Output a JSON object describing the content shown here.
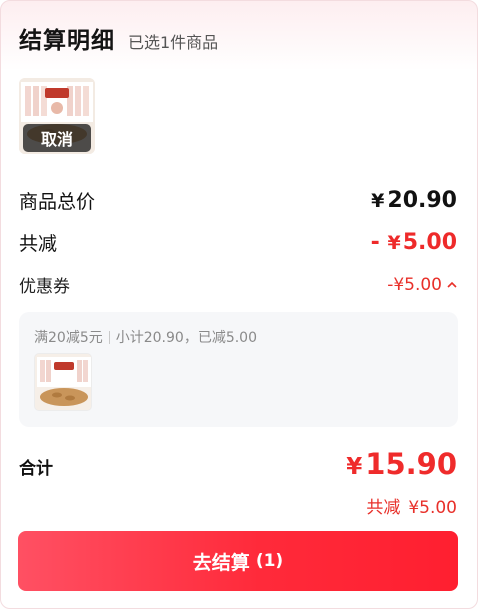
{
  "header": {
    "title": "结算明细",
    "subtitle": "已选1件商品"
  },
  "product": {
    "image_icon": "snack-package-image",
    "cancel_label": "取消"
  },
  "summary": {
    "goods_total_label": "商品总价",
    "goods_total_currency": "¥",
    "goods_total_value": "20.90",
    "discount_label": "共减",
    "discount_prefix": "-",
    "discount_currency": "¥",
    "discount_value": "5.00",
    "coupon_label": "优惠券",
    "coupon_value": "-¥5.00",
    "coupon_chevron_icon": "chevron-up-icon"
  },
  "coupon_card": {
    "rule": "满20减5元",
    "detail": "小计20.90，已减5.00"
  },
  "total": {
    "label": "合计",
    "currency": "¥",
    "value": "15.90",
    "saved_label": "共减",
    "saved_value": "¥5.00"
  },
  "checkout": {
    "label": "去结算",
    "count": "(1)"
  },
  "colors": {
    "accent_red": "#ee2a2a",
    "button_gradient_start": "#ff5063",
    "button_gradient_end": "#ff1f30"
  }
}
